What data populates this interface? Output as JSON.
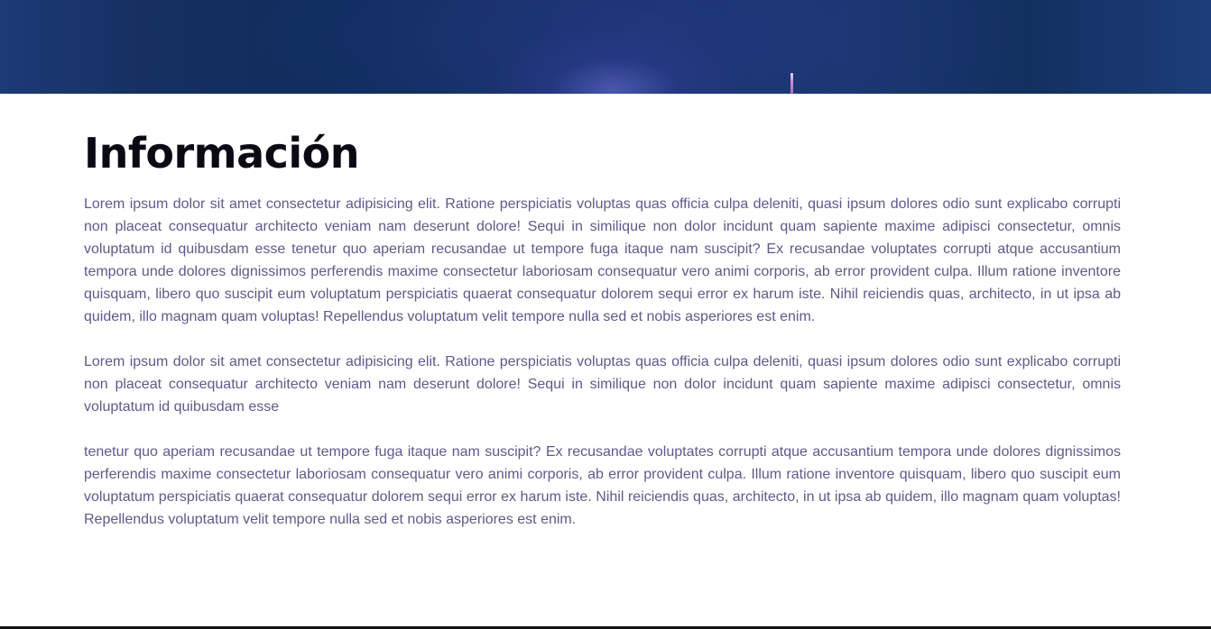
{
  "section": {
    "title": "Información",
    "paragraphs": [
      "Lorem ipsum dolor sit amet consectetur adipisicing elit. Ratione perspiciatis voluptas quas officia culpa deleniti, quasi ipsum dolores odio sunt explicabo corrupti non placeat consequatur architecto veniam nam deserunt dolore! Sequi in similique non dolor incidunt quam sapiente maxime adipisci consectetur, omnis voluptatum id quibusdam esse tenetur quo aperiam recusandae ut tempore fuga itaque nam suscipit? Ex recusandae voluptates corrupti atque accusantium tempora unde dolores dignissimos perferendis maxime consectetur laboriosam consequatur vero animi corporis, ab error provident culpa. Illum ratione inventore quisquam, libero quo suscipit eum voluptatum perspiciatis quaerat consequatur dolorem sequi error ex harum iste. Nihil reiciendis quas, architecto, in ut ipsa ab quidem, illo magnam quam voluptas! Repellendus voluptatum velit tempore nulla sed et nobis asperiores est enim.",
      "Lorem ipsum dolor sit amet consectetur adipisicing elit. Ratione perspiciatis voluptas quas officia culpa deleniti, quasi ipsum dolores odio sunt explicabo corrupti non placeat consequatur architecto veniam nam deserunt dolore! Sequi in similique non dolor incidunt quam sapiente maxime adipisci consectetur, omnis voluptatum id quibusdam esse",
      "tenetur quo aperiam recusandae ut tempore fuga itaque nam suscipit? Ex recusandae voluptates corrupti atque accusantium tempora unde dolores dignissimos perferendis maxime consectetur laboriosam consequatur vero animi corporis, ab error provident culpa. Illum ratione inventore quisquam, libero quo suscipit eum voluptatum perspiciatis quaerat consequatur dolorem sequi error ex harum iste. Nihil reiciendis quas, architecto, in ut ipsa ab quidem, illo magnam quam voluptas! Repellendus voluptatum velit tempore nulla sed et nobis asperiores est enim."
    ]
  },
  "colors": {
    "banner": "#153060",
    "title": "#0a0a14",
    "body_text": "#5e5a8a"
  }
}
